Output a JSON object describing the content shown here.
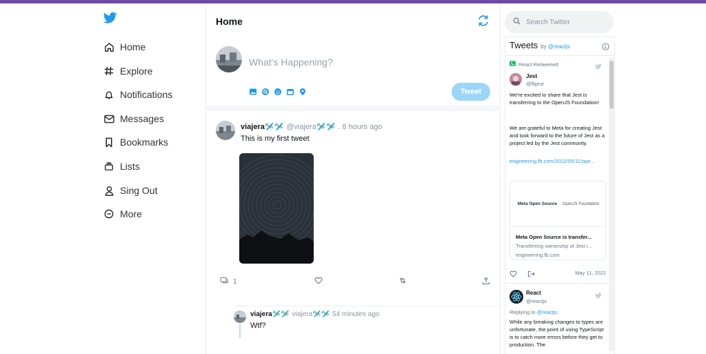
{
  "sidebar": {
    "items": [
      {
        "label": "Home",
        "icon": "home-icon"
      },
      {
        "label": "Explore",
        "icon": "hashtag-icon"
      },
      {
        "label": "Notifications",
        "icon": "bell-icon"
      },
      {
        "label": "Messages",
        "icon": "mail-icon"
      },
      {
        "label": "Bookmarks",
        "icon": "bookmark-icon"
      },
      {
        "label": "Lists",
        "icon": "list-icon"
      },
      {
        "label": "Sing Out",
        "icon": "user-icon"
      },
      {
        "label": "More",
        "icon": "more-icon"
      }
    ]
  },
  "header": {
    "title": "Home"
  },
  "compose": {
    "placeholder": "What's Happening?",
    "tweet_label": "Tweet"
  },
  "post": {
    "name": "viajera🛩️🛩️",
    "handle": "@viajera🛩️🛩️",
    "time": ". 8 hours ago",
    "text": "This is my first tweet",
    "reply_count": "1"
  },
  "reply": {
    "name": "viajera🛩️🛩️",
    "handle": "viajera🛩️🛩️",
    "time": "54 minutes ago",
    "text": "Wtf?"
  },
  "search": {
    "placeholder": "Search Twitter"
  },
  "embed": {
    "title": "Tweets",
    "by": "by",
    "by_handle": "@reactjs",
    "retweet_label": "React Retweeted",
    "tweet1": {
      "name": "Jest",
      "handle": "@fbjest",
      "p1": "We're excited to share that Jest is transferring to the OpenJS Foundation!",
      "p2": "We are grateful to Meta for creating Jest and look forward to the future of Jest as a project led by the Jest community.",
      "link": "engineering.fb.com/2022/05/11/ope...",
      "card_logo_meta": "Meta Open Source",
      "card_logo_openjs": "OpenJS Foundation",
      "card_title": "Meta Open Source is transfer...",
      "card_desc": "Transferring ownership of Jest i...",
      "card_domain": "engineering.fb.com",
      "date": "May 11, 2022"
    },
    "tweet2": {
      "name": "React",
      "handle": "@reactjs",
      "replying": "Replying to",
      "replying_handle": "@reactjs",
      "text": "While any breaking changes to types are unfortunate, the point of using TypeScript is to catch more errors before they get to production. The"
    }
  },
  "colors": {
    "accent": "#1d9bf0",
    "topbar": "#6e49a8",
    "tweet_button": "#9bd5f7"
  }
}
